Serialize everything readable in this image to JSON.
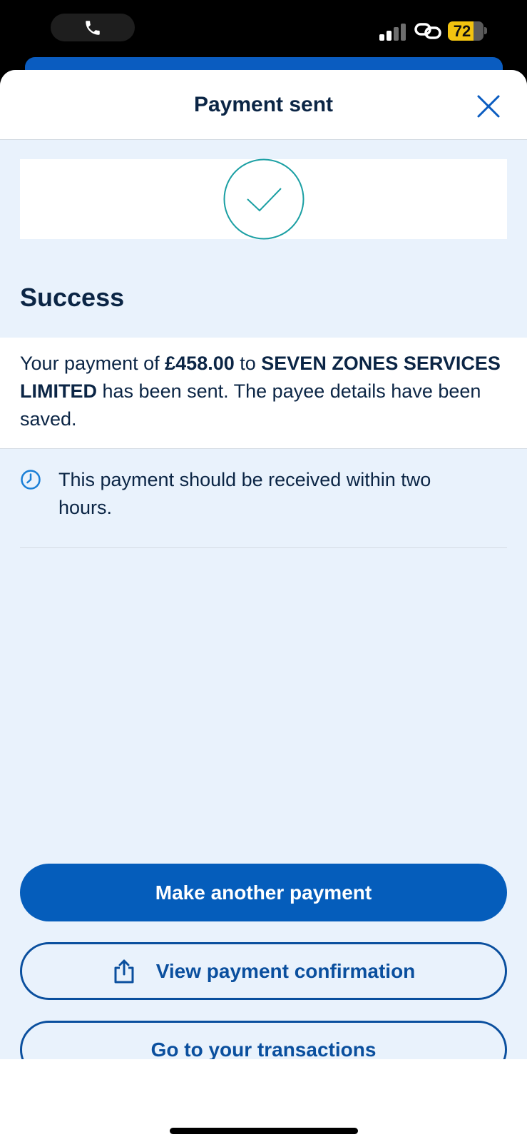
{
  "status_bar": {
    "battery_level": "72",
    "battery_fraction": 0.72,
    "icons": [
      "phone-icon",
      "signal-icon",
      "link-icon",
      "battery-icon"
    ]
  },
  "header": {
    "title": "Payment sent",
    "close_icon": "close-icon"
  },
  "status": {
    "icon": "checkmark-icon",
    "heading": "Success"
  },
  "message": {
    "prefix": "Your payment of ",
    "amount": "£458.00",
    "middle": " to ",
    "payee": "SEVEN ZONES SERVICES LIMITED",
    "suffix": " has been sent. The payee details have been saved."
  },
  "info": {
    "icon": "clock-icon",
    "text": "This payment should be received within two hours."
  },
  "actions": {
    "make_another": "Make another payment",
    "view_confirmation": "View payment confirmation",
    "go_transactions": "Go to your transactions"
  },
  "colors": {
    "primary": "#055dbb",
    "navy_text": "#0b2545",
    "sheet_bg": "#e9f2fc",
    "success_teal": "#1a9fa3"
  }
}
